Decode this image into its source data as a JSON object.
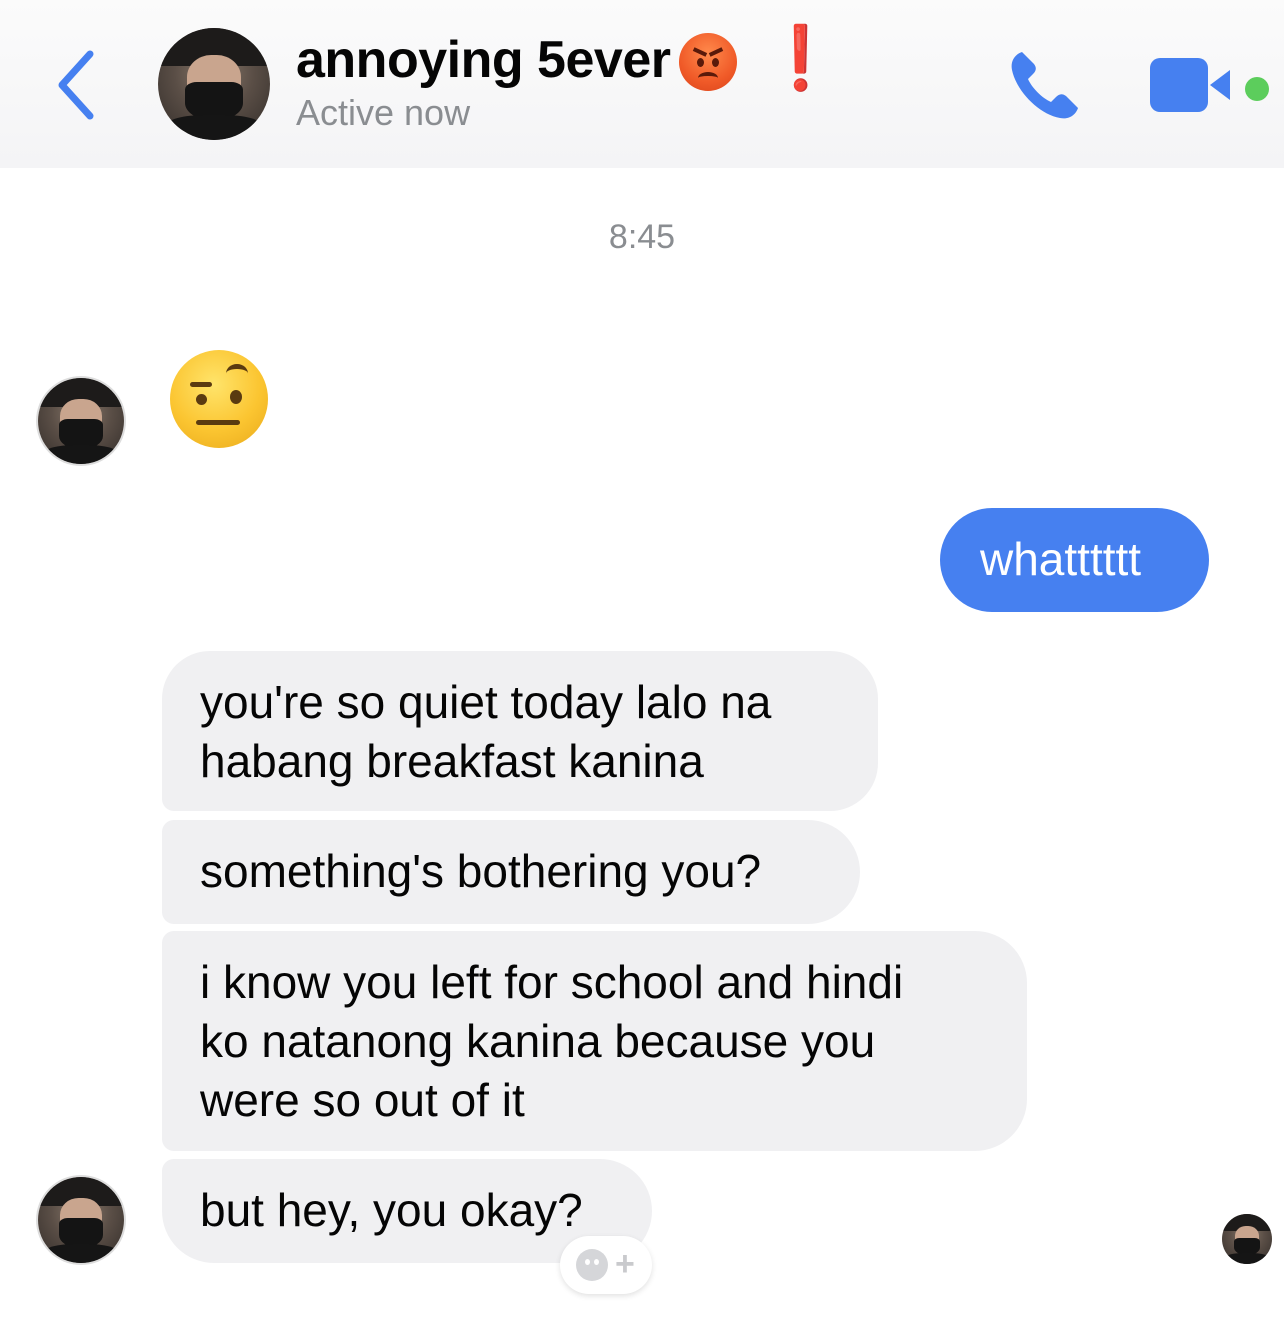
{
  "header": {
    "contact_name": "annoying 5ever",
    "name_emoji": "angry-face-emoji",
    "name_mark": "❗",
    "status": "Active now",
    "back_icon": "chevron-left-icon",
    "call_icon": "phone-icon",
    "video_icon": "video-camera-icon",
    "accent_color": "#4680f0",
    "online_color": "#5ccd5c"
  },
  "thread": {
    "timestamp": "8:45",
    "messages": [
      {
        "from": "contact",
        "type": "emoji",
        "emoji": "face-with-raised-eyebrow"
      },
      {
        "from": "me",
        "type": "text",
        "text": "whatttttt"
      },
      {
        "from": "contact",
        "type": "text",
        "lines": [
          "you're so quiet today lalo na",
          "habang breakfast kanina"
        ]
      },
      {
        "from": "contact",
        "type": "text",
        "lines": [
          "something's bothering you?"
        ]
      },
      {
        "from": "contact",
        "type": "text",
        "lines": [
          "i know you left for school and hindi",
          "ko natanong kanina because you",
          "were so out of it"
        ]
      },
      {
        "from": "contact",
        "type": "text",
        "lines": [
          "but hey, you okay?"
        ]
      }
    ],
    "reaction_button_icon": "add-reaction-icon",
    "reaction_plus": "+",
    "bubble_colors": {
      "outgoing": "#4680f0",
      "incoming": "#f0f0f2"
    }
  }
}
